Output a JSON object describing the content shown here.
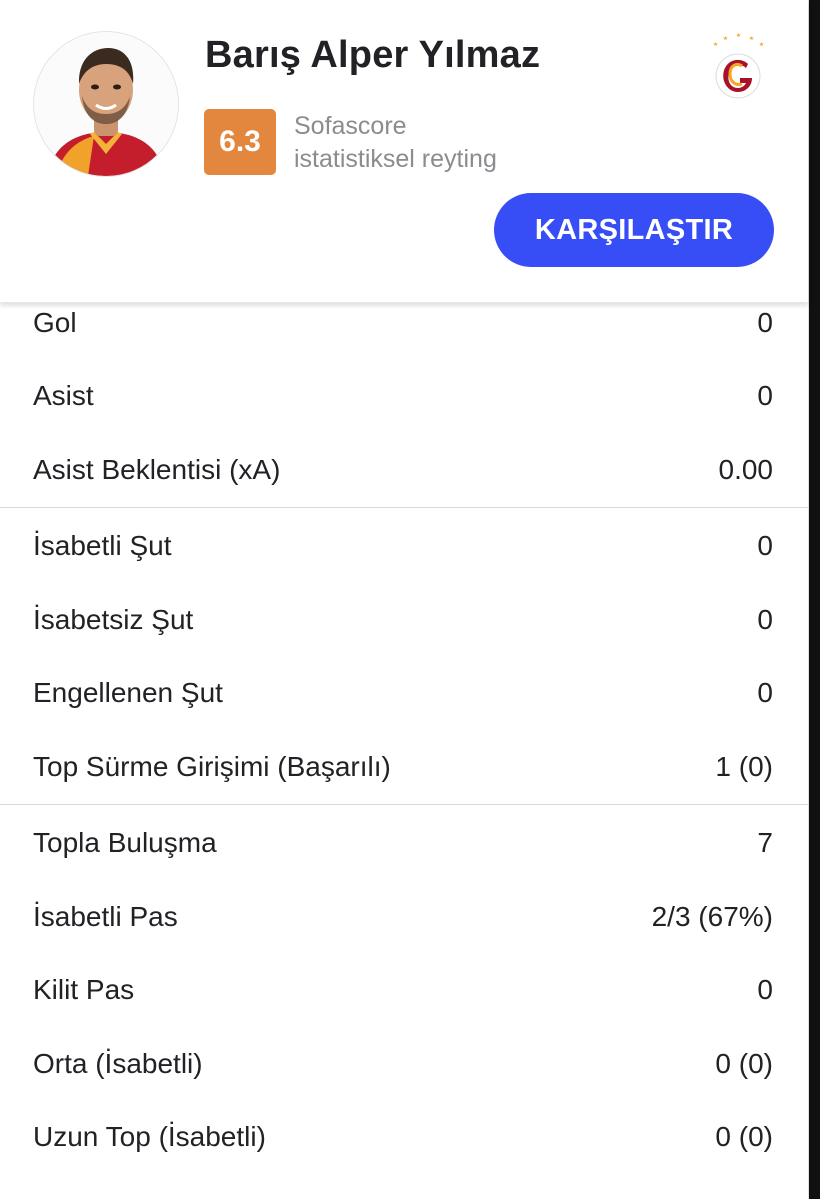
{
  "player": {
    "name": "Barış Alper Yılmaz",
    "rating": "6.3",
    "rating_caption_line1": "Sofascore",
    "rating_caption_line2": "istatistiksel reyting",
    "compare_label": "KARŞILAŞTIR"
  },
  "colors": {
    "accent": "#374df5",
    "rating": "#e3873f",
    "club_primary": "#a9112a",
    "club_secondary": "#f5a623"
  },
  "stats": {
    "group1": [
      {
        "label": "Gol",
        "value": "0"
      },
      {
        "label": "Asist",
        "value": "0"
      },
      {
        "label": "Asist Beklentisi (xA)",
        "value": "0.00"
      }
    ],
    "group2": [
      {
        "label": "İsabetli Şut",
        "value": "0"
      },
      {
        "label": "İsabetsiz Şut",
        "value": "0"
      },
      {
        "label": "Engellenen Şut",
        "value": "0"
      },
      {
        "label": "Top Sürme Girişimi (Başarılı)",
        "value": "1 (0)"
      }
    ],
    "group3": [
      {
        "label": "Topla Buluşma",
        "value": "7"
      },
      {
        "label": "İsabetli Pas",
        "value": "2/3 (67%)"
      },
      {
        "label": "Kilit Pas",
        "value": "0"
      },
      {
        "label": "Orta (İsabetli)",
        "value": "0 (0)"
      },
      {
        "label": "Uzun Top (İsabetli)",
        "value": "0 (0)"
      }
    ]
  }
}
